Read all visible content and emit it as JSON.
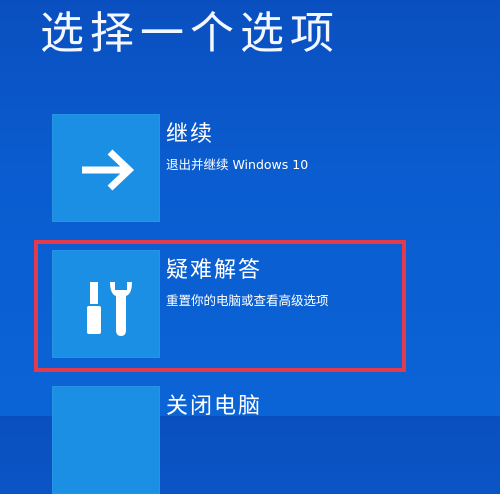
{
  "title": "选择一个选项",
  "options": [
    {
      "label": "继续",
      "description": "退出并继续 Windows 10",
      "icon": "arrow-right-icon"
    },
    {
      "label": "疑难解答",
      "description": "重置你的电脑或查看高级选项",
      "icon": "tools-icon"
    },
    {
      "label": "关闭电脑",
      "description": "",
      "icon": "power-icon"
    }
  ],
  "colors": {
    "background": "#0b5ed0",
    "tile": "#1b8fe4",
    "highlight_border": "#e23b4e",
    "text": "#ffffff"
  }
}
